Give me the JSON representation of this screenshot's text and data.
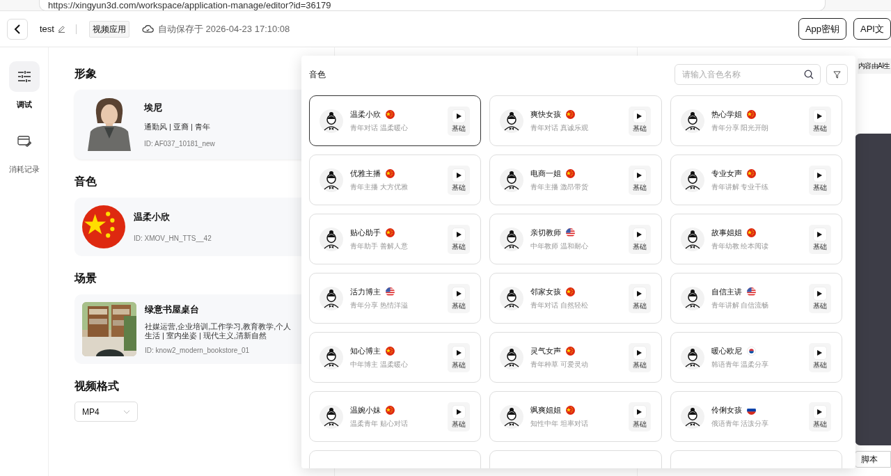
{
  "browser": {
    "url": "https://xingyun3d.com/workspace/application-manage/editor?id=36179"
  },
  "header": {
    "title": "test",
    "app_type": "视频应用",
    "autosave": "自动保存于 2026-04-23 17:10:08",
    "buttons": [
      "App密钥",
      "API文"
    ]
  },
  "nav": [
    {
      "label": "调试",
      "selected": true,
      "kind": "tune"
    },
    {
      "label": "消耗记录",
      "selected": false,
      "kind": "record"
    }
  ],
  "avatar_section": {
    "heading": "形象",
    "name": "埃尼",
    "tags": "通勤风 | 亚裔 | 青年",
    "id": "ID: AF037_10181_new"
  },
  "voice_section": {
    "heading": "音色",
    "name": "温柔小欣",
    "id": "ID: XMOV_HN_TTS__42",
    "kind": "cn"
  },
  "scene_section": {
    "heading": "场景",
    "name": "绿意书屋桌台",
    "tags": "社媒运营,企业培训,工作学习,教育教学,个人生活 | 室内坐姿 | 现代主义,清新自然",
    "id": "ID: know2_modern_bookstore_01"
  },
  "format_section": {
    "heading": "视频格式",
    "value": "MP4"
  },
  "voice_picker": {
    "title": "音色",
    "search_placeholder": "请输入音色名称",
    "voices": [
      {
        "name": "温柔小欣",
        "kind": "cn",
        "desc": "青年对话 温柔暖心",
        "tier": "基础",
        "selected": true
      },
      {
        "name": "爽快女孩",
        "kind": "cn",
        "desc": "青年对话 真诚乐观",
        "tier": "基础",
        "selected": false
      },
      {
        "name": "热心学姐",
        "kind": "cn",
        "desc": "青年分享 阳光开朗",
        "tier": "基础",
        "selected": false
      },
      {
        "name": "优雅主播",
        "kind": "cn",
        "desc": "青年主播 大方优雅",
        "tier": "基础",
        "selected": false
      },
      {
        "name": "电商一姐",
        "kind": "cn",
        "desc": "青年主播 激昂带货",
        "tier": "基础",
        "selected": false
      },
      {
        "name": "专业女声",
        "kind": "cn",
        "desc": "青年讲解 专业干练",
        "tier": "基础",
        "selected": false
      },
      {
        "name": "贴心助手",
        "kind": "cn",
        "desc": "青年助手 善解人意",
        "tier": "基础",
        "selected": false
      },
      {
        "name": "亲切教师",
        "kind": "us",
        "desc": "中年教师 温和耐心",
        "tier": "基础",
        "selected": false
      },
      {
        "name": "故事姐姐",
        "kind": "cn",
        "desc": "青年幼教 绘本阅读",
        "tier": "基础",
        "selected": false
      },
      {
        "name": "活力博主",
        "kind": "us",
        "desc": "青年分享 热情洋溢",
        "tier": "基础",
        "selected": false
      },
      {
        "name": "邻家女孩",
        "kind": "cn",
        "desc": "青年对话 自然轻松",
        "tier": "基础",
        "selected": false
      },
      {
        "name": "自信主讲",
        "kind": "us",
        "desc": "青年讲解 自信流畅",
        "tier": "基础",
        "selected": false
      },
      {
        "name": "知心博主",
        "kind": "cn",
        "desc": "中年博主 温柔暖心",
        "tier": "基础",
        "selected": false
      },
      {
        "name": "灵气女声",
        "kind": "cn",
        "desc": "青年种草 可爱灵动",
        "tier": "基础",
        "selected": false
      },
      {
        "name": "暖心欧尼",
        "kind": "kr",
        "desc": "韩语青年 温柔分享",
        "tier": "基础",
        "selected": false
      },
      {
        "name": "温婉小妹",
        "kind": "cn",
        "desc": "温柔青年 贴心对话",
        "tier": "基础",
        "selected": false
      },
      {
        "name": "飒爽姐姐",
        "kind": "cn",
        "desc": "知性中年 坦率对话",
        "tier": "基础",
        "selected": false
      },
      {
        "name": "伶俐女孩",
        "kind": "ru",
        "desc": "俄语青年 活泼分享",
        "tier": "基础",
        "selected": false
      }
    ]
  },
  "right_panel": {
    "notice": "内容由AI生",
    "button": "脚本"
  }
}
